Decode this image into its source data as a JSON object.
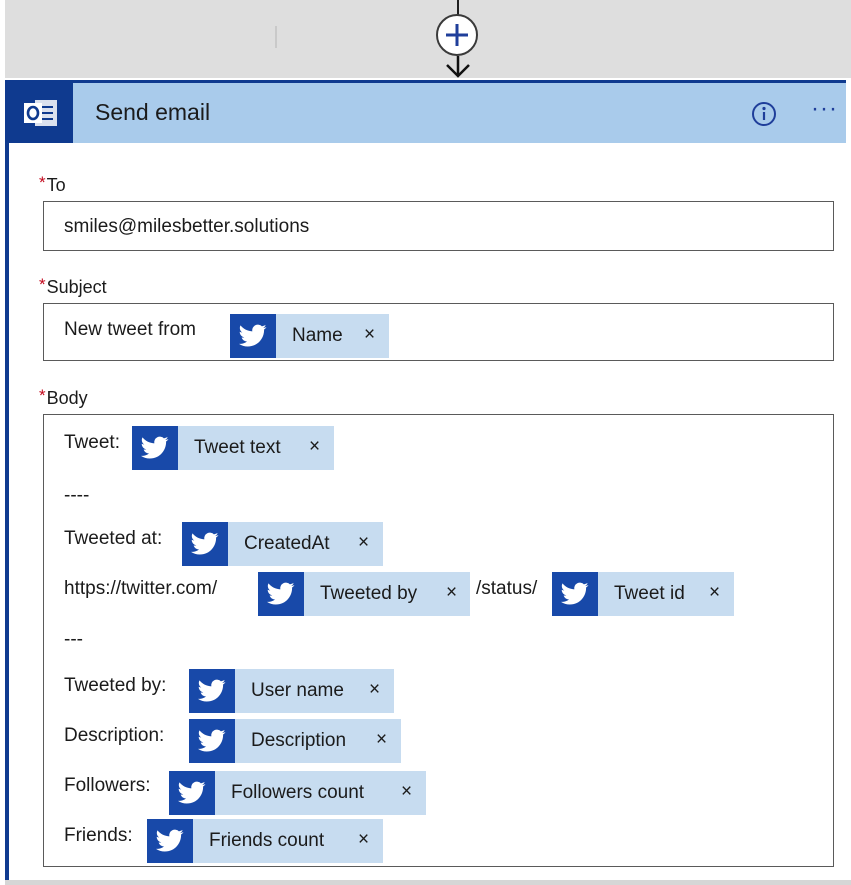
{
  "card": {
    "title": "Send email",
    "info_icon": "info-circle-icon",
    "more_label": "···",
    "app_icon": "outlook-icon"
  },
  "connector": {
    "add_icon": "plus-circle-icon",
    "arrow_icon": "arrow-down-icon"
  },
  "fields": {
    "to": {
      "required_mark": "*",
      "label": "To",
      "value": "smiles@milesbetter.solutions"
    },
    "subject": {
      "required_mark": "*",
      "label": "Subject",
      "prefix": "New tweet from",
      "token": "Name"
    },
    "body": {
      "required_mark": "*",
      "label": "Body",
      "tweet_label": "Tweet:",
      "tweet_token": "Tweet text",
      "separator1": "----",
      "tweeted_at_label": "Tweeted at:",
      "tweeted_at_token": "CreatedAt",
      "url_prefix": "https://twitter.com/",
      "tweeted_by_token": "Tweeted by",
      "status_text": "/status/",
      "tweet_id_token": "Tweet id",
      "separator2": "---",
      "tweeted_by_label": "Tweeted by:",
      "user_name_token": "User name",
      "description_label": "Description:",
      "description_token": "Description",
      "followers_label": "Followers:",
      "followers_token": "Followers count",
      "friends_label": "Friends:",
      "friends_token": "Friends count"
    }
  },
  "token_remove": "×",
  "token_icon": "twitter-bird-icon",
  "colors": {
    "header_bg": "#a9cbeb",
    "accent_blue": "#0f3a8f",
    "twitter_tile": "#1849a9",
    "token_bg": "#c7dcf0",
    "required_red": "#c2071b"
  }
}
